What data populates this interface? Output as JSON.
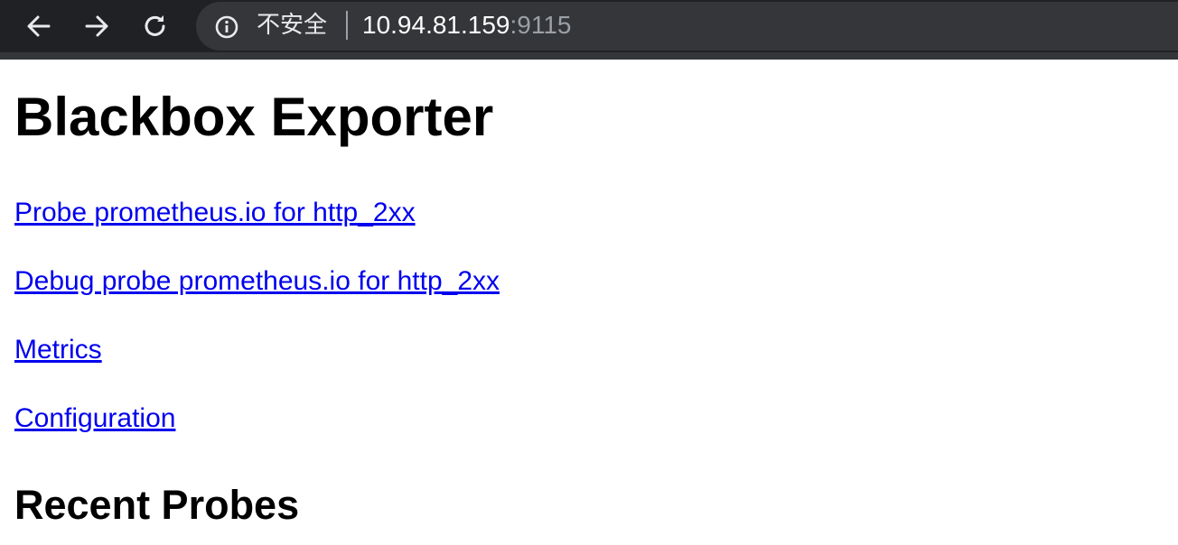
{
  "browser": {
    "security_label": "不安全",
    "url_host": "10.94.81.159",
    "url_port": ":9115",
    "icons": {
      "back": "arrow-left-icon",
      "forward": "arrow-right-icon",
      "reload": "reload-icon",
      "info": "info-icon"
    },
    "colors": {
      "toolbar": "#202124",
      "omnibox": "#35363a",
      "url_host": "#ffffff",
      "url_port": "#9aa0a6"
    }
  },
  "page": {
    "title": "Blackbox Exporter",
    "links": [
      "Probe prometheus.io for http_2xx",
      "Debug probe prometheus.io for http_2xx",
      "Metrics",
      "Configuration"
    ],
    "section_title": "Recent Probes",
    "link_color": "#0000ee"
  }
}
